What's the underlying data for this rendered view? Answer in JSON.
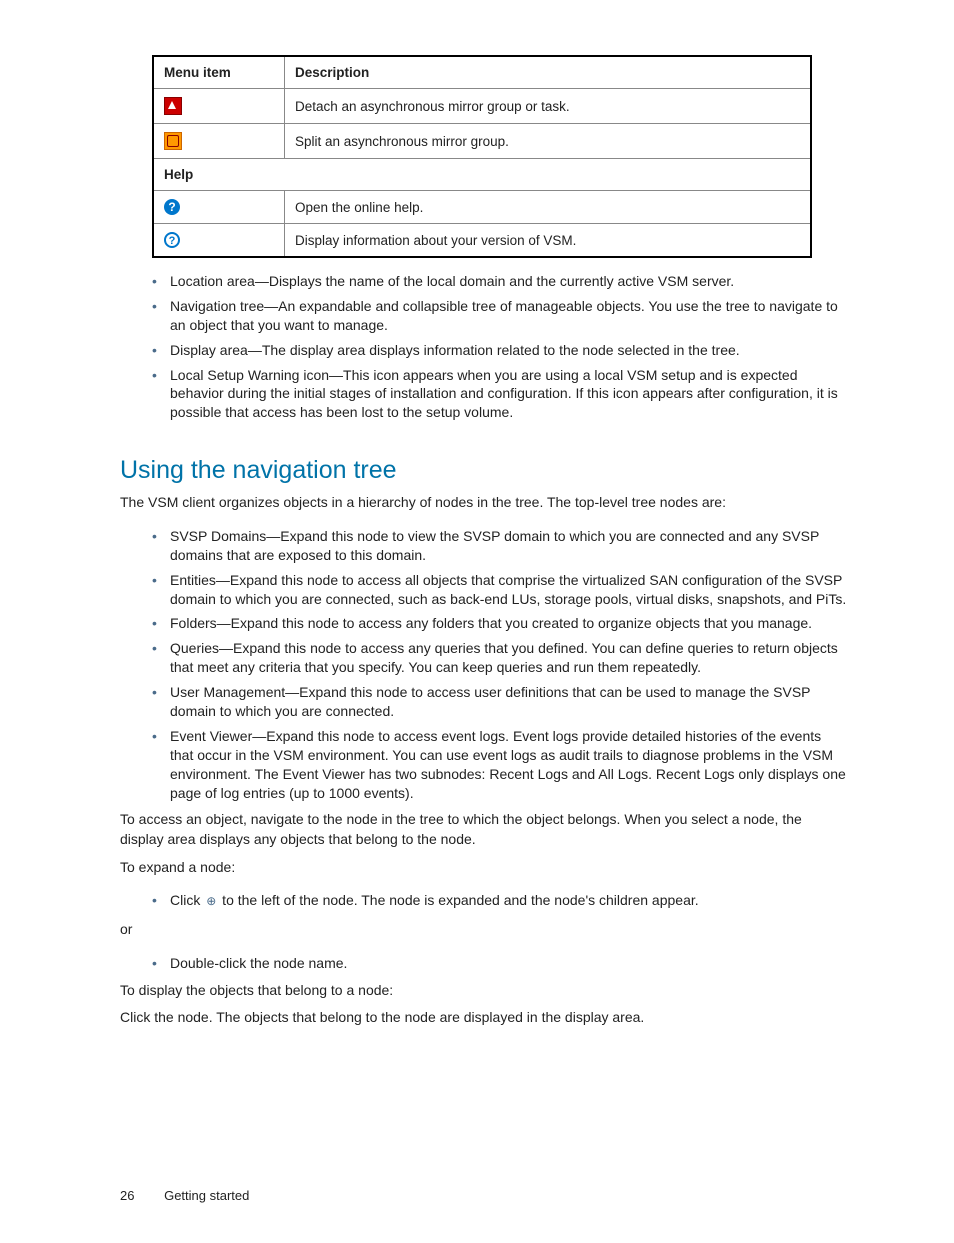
{
  "table": {
    "headers": {
      "col1": "Menu item",
      "col2": "Description"
    },
    "row_detach": "Detach an asynchronous mirror group or task.",
    "row_split": "Split an asynchronous mirror group.",
    "section_help": "Help",
    "row_help_open": "Open the online help.",
    "row_help_about": "Display information about your version of VSM."
  },
  "list_a": {
    "i0": "Location area—Displays the name of the local domain and the currently active VSM server.",
    "i1": "Navigation tree—An expandable and collapsible tree of manageable objects. You use the tree to navigate to an object that you want to manage.",
    "i2": "Display area—The display area displays information related to the node selected in the tree.",
    "i3": "Local Setup Warning icon—This icon appears when you are using a local VSM setup and is expected behavior during the initial stages of installation and configuration. If this icon appears after configuration, it is possible that access has been lost to the setup volume."
  },
  "heading": "Using the navigation tree",
  "intro": "The VSM client organizes objects in a hierarchy of nodes in the tree. The top-level tree nodes are:",
  "list_b": {
    "i0": "SVSP Domains—Expand this node to view the SVSP domain to which you are connected and any SVSP domains that are exposed to this domain.",
    "i1": "Entities—Expand this node to access all objects that comprise the virtualized SAN configuration of the SVSP domain to which you are connected, such as back-end LUs, storage pools, virtual disks, snapshots, and PiTs.",
    "i2": "Folders—Expand this node to access any folders that you created to organize objects that you manage.",
    "i3": "Queries—Expand this node to access any queries that you defined. You can define queries to return objects that meet any criteria that you specify. You can keep queries and run them repeatedly.",
    "i4": "User Management—Expand this node to access user definitions that can be used to manage the SVSP domain to which you are connected.",
    "i5": "Event Viewer—Expand this node to access event logs. Event logs provide detailed histories of the events that occur in the VSM environment. You can use event logs as audit trails to diagnose problems in the VSM environment. The Event Viewer has two subnodes: Recent Logs and All Logs. Recent Logs only displays one page of log entries (up to 1000 events)."
  },
  "para_access": "To access an object, navigate to the node in the tree to which the object belongs. When you select a node, the display area displays any objects that belong to the node.",
  "para_expand": "To expand a node:",
  "bullet_click_before": "Click ",
  "bullet_click_after": " to the left of the node. The node is expanded and the node's children appear.",
  "or": "or",
  "bullet_dblclick": "Double-click the node name.",
  "para_display": "To display the objects that belong to a node:",
  "para_clicknode": "Click the node. The objects that belong to the node are displayed in the display area.",
  "footer": {
    "page": "26",
    "section": "Getting started"
  }
}
